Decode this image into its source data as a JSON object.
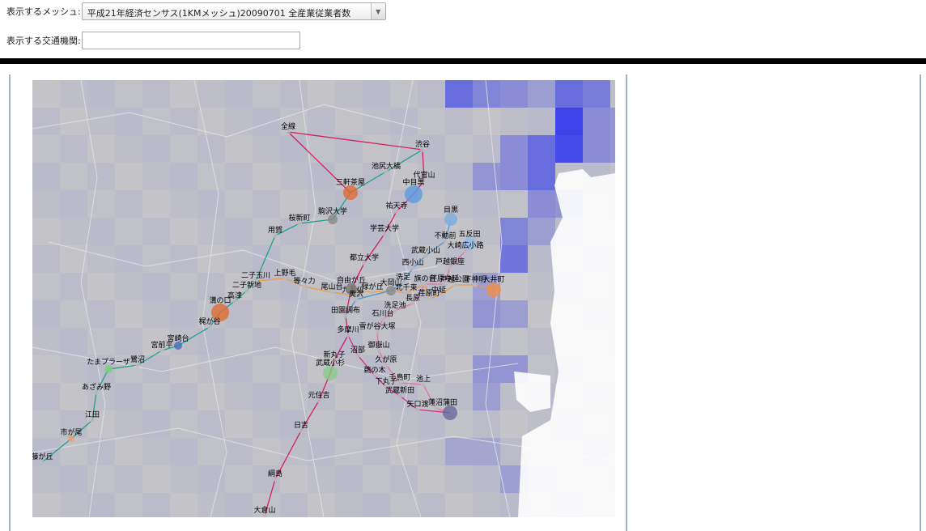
{
  "controls": {
    "mesh_label": "表示するメッシュ:",
    "mesh_selected": "平成21年経済センサス(1KMメッシュ)20090701 全産業従業者数",
    "transport_label": "表示する交通機関:",
    "transport_value": ""
  },
  "map": {
    "colors": {
      "base": "#c7c7c7",
      "heat": "#1a22f0",
      "water": "#ffffff",
      "land_lines": "#e6e6e6"
    },
    "stations": [
      "全線",
      "渋谷",
      "池尻大橋",
      "代官山",
      "三軒茶屋",
      "中目黒",
      "駒沢大学",
      "桜新町",
      "祐天寺",
      "目黒",
      "用賀",
      "学芸大学",
      "不動前",
      "五反田",
      "大崎広小路",
      "都立大学",
      "武蔵小山",
      "西小山",
      "戸越銀座",
      "二子玉川",
      "上野毛",
      "二子新地",
      "等々力",
      "尾山台",
      "九品仏",
      "自由が丘",
      "緑が丘",
      "大岡山",
      "北千束",
      "洗足",
      "旗の台",
      "荏原中延",
      "中延",
      "長原",
      "荏原町",
      "戸越公園",
      "下神明",
      "大井町",
      "溝の口",
      "高津",
      "奥沢",
      "田園調布",
      "洗足池",
      "石川台",
      "梶が谷",
      "宮崎台",
      "宮前平",
      "多摩川",
      "雪が谷大塚",
      "沼部",
      "御嶽山",
      "鷺沼",
      "新丸子",
      "久が原",
      "たまプラーザ",
      "武蔵小杉",
      "鵜の木",
      "千鳥町",
      "下丸子",
      "池上",
      "武蔵新田",
      "あざみ野",
      "元住吉",
      "矢口渡",
      "蓮沼",
      "蒲田",
      "江田",
      "日吉",
      "市が尾",
      "藤が丘",
      "綱島",
      "大倉山"
    ]
  }
}
